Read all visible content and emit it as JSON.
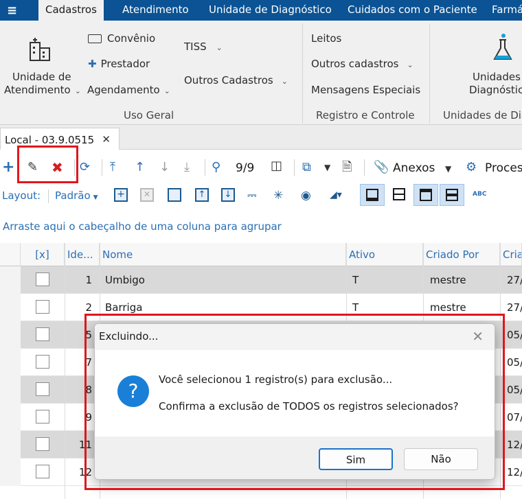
{
  "tabs": [
    "Cadastros",
    "Atendimento",
    "Unidade de Diagnóstico",
    "Cuidados com o Paciente",
    "Farmá"
  ],
  "ribbon": {
    "unidade_line1": "Unidade de",
    "unidade_line2": "Atendimento",
    "convenio": "Convênio",
    "prestador": "Prestador",
    "agendamento": "Agendamento",
    "tiss": "TISS",
    "outros_cadastros_main": "Outros Cadastros",
    "group_uso_geral": "Uso Geral",
    "leitos": "Leitos",
    "outros_cadastros": "Outros cadastros",
    "mensagens": "Mensagens  Especiais",
    "group_registro": "Registro e Controle",
    "unidades_line1": "Unidades",
    "unidades_line2": "Diagnóstico",
    "group_unidades": "Unidades de Dia"
  },
  "doc_tab": "Local - 03.9.0515",
  "toolbar": {
    "record_count": "9/9",
    "anexos": "Anexos",
    "processos": "Proces",
    "layout_label": "Layout:",
    "layout_value": "Padrão"
  },
  "group_panel": "Arraste aqui o cabeçalho de uma coluna para agrupar",
  "columns": [
    "[x]",
    "Ide...",
    "Nome",
    "Ativo",
    "Criado Por",
    "Cria"
  ],
  "rows": [
    {
      "id": "1",
      "nome": "Umbigo",
      "ativo": "T",
      "criado_por": "mestre",
      "criado_em": "27/"
    },
    {
      "id": "2",
      "nome": "Barriga",
      "ativo": "T",
      "criado_por": "mestre",
      "criado_em": "27/"
    },
    {
      "id": "5",
      "nome": "",
      "ativo": "",
      "criado_por": "",
      "criado_em": "05/"
    },
    {
      "id": "7",
      "nome": "",
      "ativo": "",
      "criado_por": "",
      "criado_em": "05/"
    },
    {
      "id": "8",
      "nome": "",
      "ativo": "",
      "criado_por": "",
      "criado_em": "05/"
    },
    {
      "id": "9",
      "nome": "",
      "ativo": "",
      "criado_por": "",
      "criado_em": "07/"
    },
    {
      "id": "11",
      "nome": "",
      "ativo": "",
      "criado_por": "",
      "criado_em": "12/"
    },
    {
      "id": "12",
      "nome": "",
      "ativo": "",
      "criado_por": "",
      "criado_em": "12/"
    }
  ],
  "dialog": {
    "title": "Excluindo...",
    "message1": "Você selecionou 1 registro(s) para exclusão...",
    "message2": "Confirma a exclusão de TODOS os registros selecionados?",
    "yes": "Sim",
    "no": "Não"
  },
  "colors": {
    "accent": "#0b5394",
    "link_blue": "#2a6fb5",
    "highlight_red": "#e0161c",
    "dialog_icon": "#1a7fd6"
  }
}
